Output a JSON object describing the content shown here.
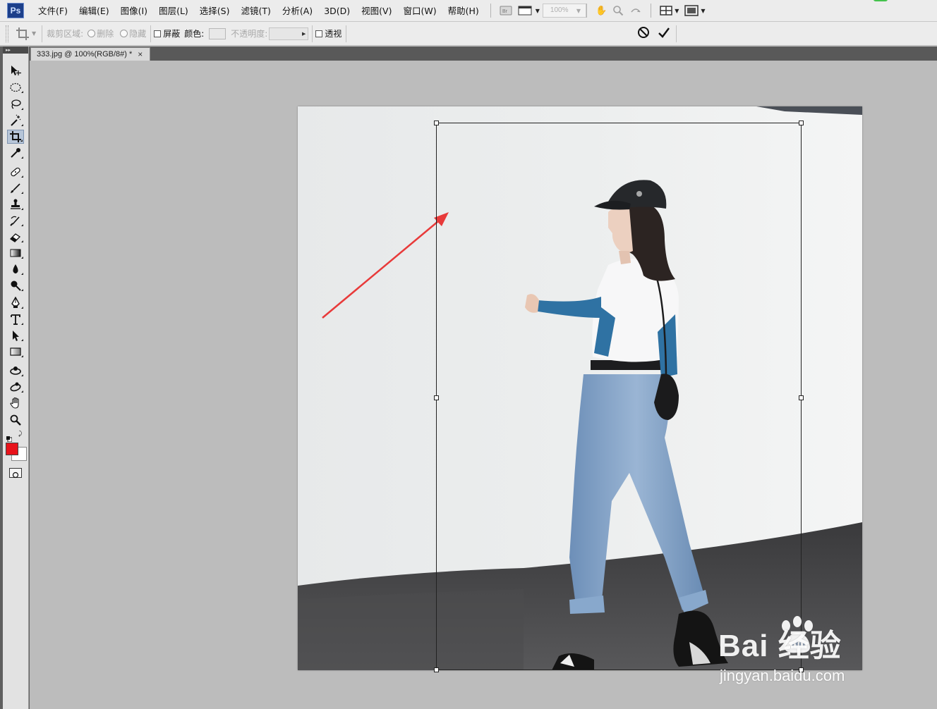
{
  "app": {
    "logo": "Ps",
    "menu": [
      "文件(F)",
      "编辑(E)",
      "图像(I)",
      "图层(L)",
      "选择(S)",
      "滤镜(T)",
      "分析(A)",
      "3D(D)",
      "视图(V)",
      "窗口(W)",
      "帮助(H)"
    ],
    "menubar_icons": [
      "bridge-icon",
      "mini-bridge-icon",
      "hand-icon",
      "zoom-icon",
      "rotate-view-icon",
      "arrange-documents-icon",
      "screen-mode-icon"
    ],
    "zoom_level": "100%"
  },
  "options": {
    "crop_area_label": "裁剪区域:",
    "delete_label": "删除",
    "hide_label": "隐藏",
    "shield_label": "屏蔽",
    "color_label": "颜色:",
    "opacity_label": "不透明度:",
    "perspective_label": "透视",
    "cancel_icon": "cancel-icon",
    "commit_icon": "commit-checkmark-icon"
  },
  "document": {
    "tab_title": "333.jpg @ 100%(RGB/8#) *",
    "close_symbol": "×"
  },
  "tools": {
    "active_tool": "crop-tool",
    "foreground_color": "#e8131b",
    "background_color": "#ffffff"
  },
  "colors": {
    "arrow_annotation": "#e83a3a",
    "jacket_blue": "#2e6f9e",
    "jeans_blue": "#7b9dc3"
  },
  "watermark": {
    "brand": "Bai  经验",
    "url": "jingyan.baidu.com"
  }
}
